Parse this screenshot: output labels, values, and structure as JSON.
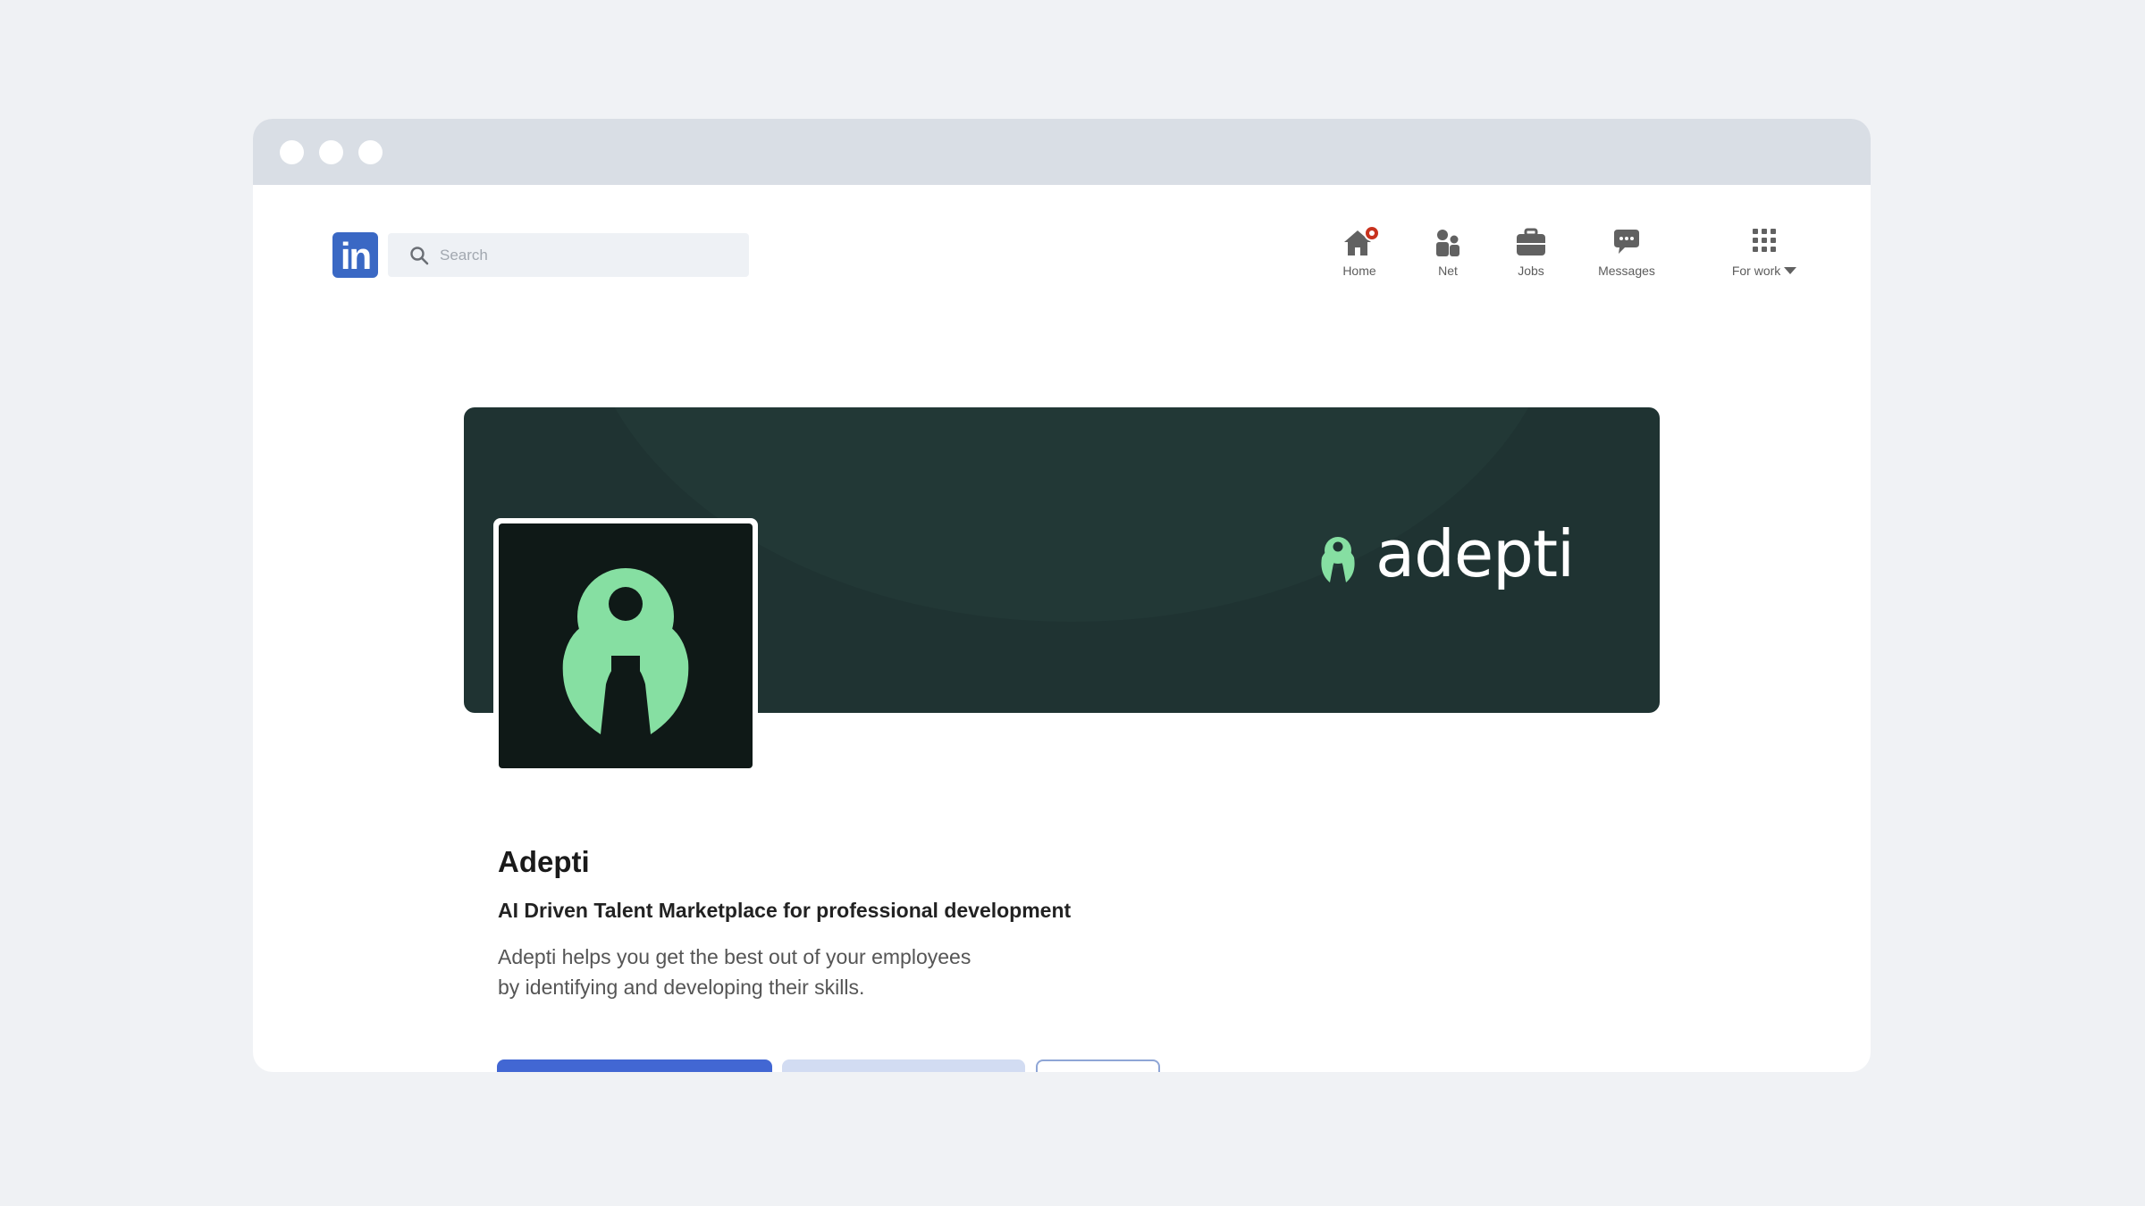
{
  "search": {
    "placeholder": "Search"
  },
  "nav": {
    "items": [
      {
        "label": "Home",
        "icon": "home-icon"
      },
      {
        "label": "Net",
        "icon": "people-icon"
      },
      {
        "label": "Jobs",
        "icon": "briefcase-icon"
      },
      {
        "label": "Messages",
        "icon": "chat-icon"
      },
      {
        "label": "For work",
        "icon": "grid-icon"
      }
    ]
  },
  "banner": {
    "brand_text": "adepti"
  },
  "profile": {
    "name": "Adepti",
    "tagline": "AI Driven Talent Marketplace for professional development",
    "description_lines": [
      "Adepti helps you get the best out of your employees",
      "by identifying and developing their skills."
    ]
  },
  "colors": {
    "linkedin_blue": "#3a68c4",
    "banner_bg": "#1f3332",
    "brand_green": "#86dfa2",
    "primary_button": "#4267d3",
    "secondary_button": "#d2dcf2",
    "notification": "#c8321e"
  }
}
